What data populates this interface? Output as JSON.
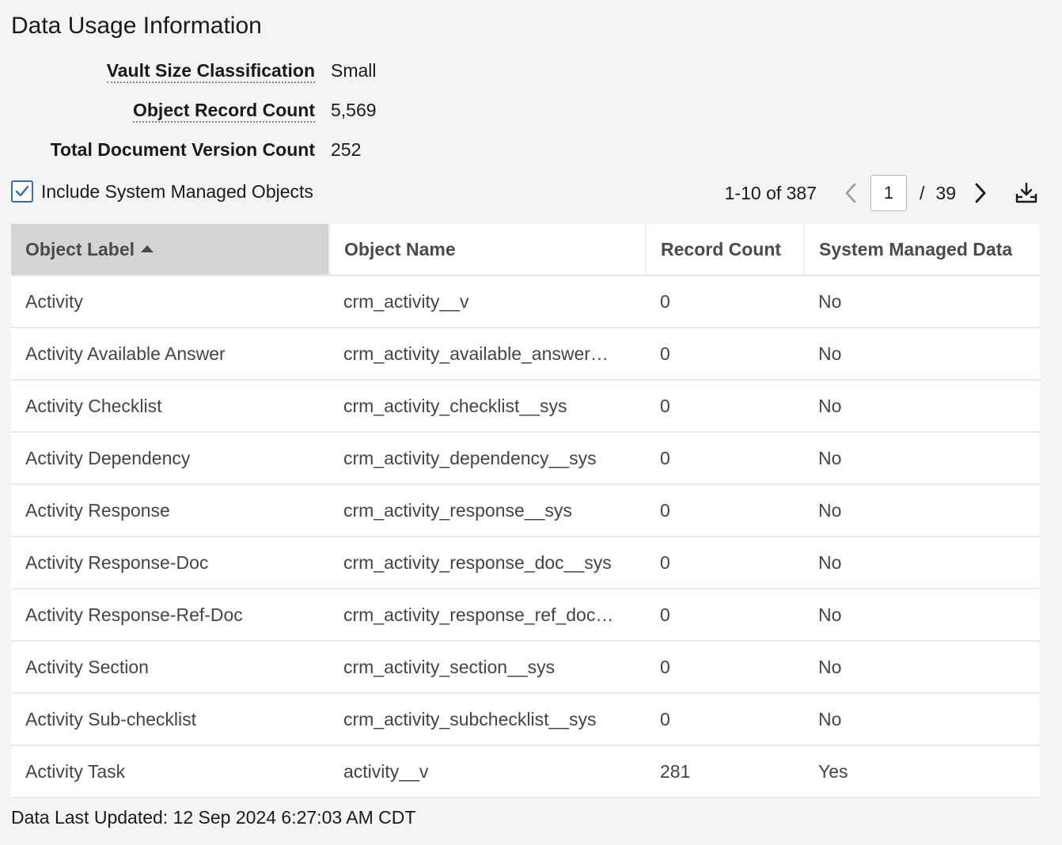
{
  "page": {
    "title": "Data Usage Information"
  },
  "summary": {
    "vault_size_label": "Vault Size Classification",
    "vault_size_value": "Small",
    "object_record_count_label": "Object Record Count",
    "object_record_count_value": "5,569",
    "total_doc_version_label": "Total Document Version Count",
    "total_doc_version_value": "252"
  },
  "controls": {
    "include_system_label": "Include System Managed Objects",
    "include_system_checked": true,
    "range_text": "1-10 of 387",
    "current_page": "1",
    "page_separator": "/",
    "total_pages": "39",
    "icons": {
      "prev": "chevron-left-icon",
      "next": "chevron-right-icon",
      "export": "download-tray-icon",
      "check": "checkmark-icon"
    }
  },
  "table": {
    "columns": [
      "Object Label",
      "Object Name",
      "Record Count",
      "System Managed Data"
    ],
    "sorted_column": "Object Label",
    "sort_direction": "ascending",
    "rows": [
      [
        "Activity",
        "crm_activity__v",
        "0",
        "No"
      ],
      [
        "Activity Available Answer",
        "crm_activity_available_answer…",
        "0",
        "No"
      ],
      [
        "Activity Checklist",
        "crm_activity_checklist__sys",
        "0",
        "No"
      ],
      [
        "Activity Dependency",
        "crm_activity_dependency__sys",
        "0",
        "No"
      ],
      [
        "Activity Response",
        "crm_activity_response__sys",
        "0",
        "No"
      ],
      [
        "Activity Response-Doc",
        "crm_activity_response_doc__sys",
        "0",
        "No"
      ],
      [
        "Activity Response-Ref-Doc",
        "crm_activity_response_ref_doc…",
        "0",
        "No"
      ],
      [
        "Activity Section",
        "crm_activity_section__sys",
        "0",
        "No"
      ],
      [
        "Activity Sub-checklist",
        "crm_activity_subchecklist__sys",
        "0",
        "No"
      ],
      [
        "Activity Task",
        "activity__v",
        "281",
        "Yes"
      ]
    ]
  },
  "footer": {
    "last_updated": "Data Last Updated: 12 Sep 2024 6:27:03 AM CDT"
  },
  "colors": {
    "accent": "#2f6bbf",
    "sorted_header_bg": "#d4d4d4",
    "page_bg": "#f4f4f4"
  }
}
